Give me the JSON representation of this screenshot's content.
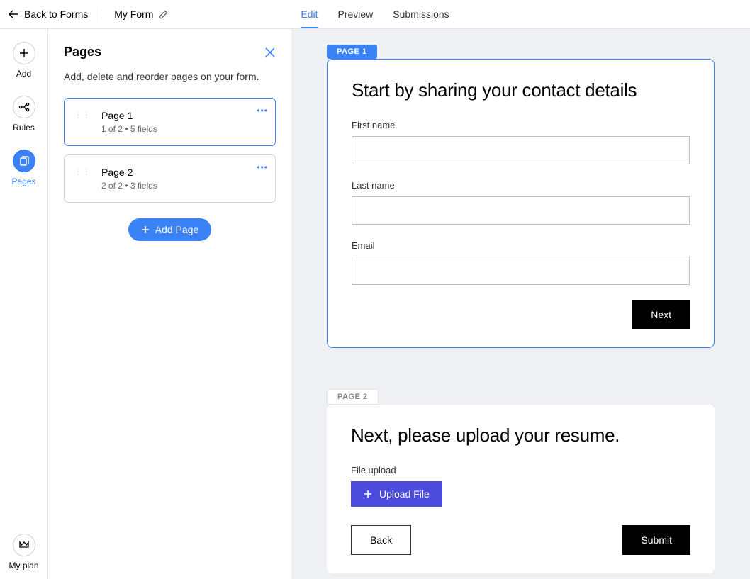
{
  "header": {
    "back_label": "Back to Forms",
    "form_name": "My Form",
    "tabs": {
      "edit": "Edit",
      "preview": "Preview",
      "submissions": "Submissions"
    }
  },
  "rail": {
    "add": "Add",
    "rules": "Rules",
    "pages": "Pages",
    "my_plan": "My plan"
  },
  "panel": {
    "title": "Pages",
    "subtitle": "Add, delete and reorder pages on your form.",
    "items": [
      {
        "title": "Page 1",
        "meta": "1 of 2  •  5 fields"
      },
      {
        "title": "Page 2",
        "meta": "2 of 2  •  3 fields"
      }
    ],
    "add_page": "Add Page"
  },
  "preview": {
    "page1": {
      "tag": "PAGE 1",
      "heading": "Start by sharing your contact details",
      "fields": {
        "first_name": "First name",
        "last_name": "Last name",
        "email": "Email"
      },
      "next": "Next"
    },
    "page2": {
      "tag": "PAGE 2",
      "heading": "Next, please upload your resume.",
      "file_label": "File upload",
      "upload": "Upload File",
      "back": "Back",
      "submit": "Submit"
    }
  }
}
